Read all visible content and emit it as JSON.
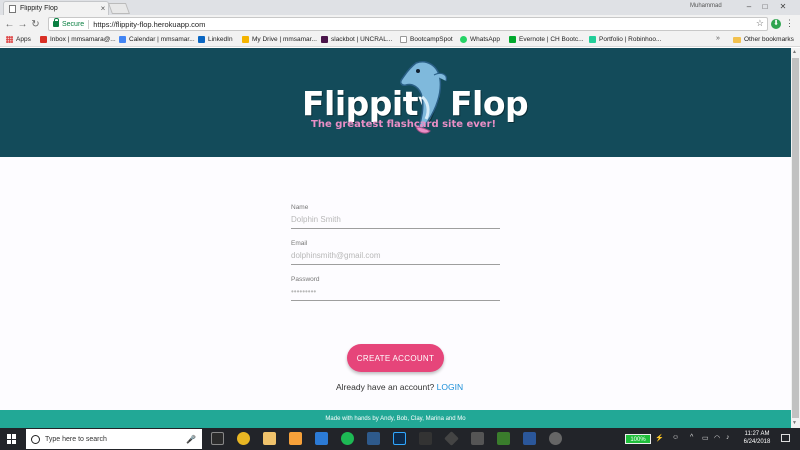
{
  "browser": {
    "tab_title": "Flippity Flop",
    "profile_name": "Muhammad",
    "secure_label": "Secure",
    "url": "https://flippity-flop.herokuapp.com",
    "bookmarks": [
      "Apps",
      "Inbox | mmsamara@...",
      "Calendar | mmsamar...",
      "LinkedIn",
      "My Drive | mmsamar...",
      "slackbot | UNCRAL...",
      "BootcampSpot",
      "WhatsApp",
      "Evernote | CH Bootc...",
      "Portfolio | Robinhoo...",
      "Other bookmarks"
    ],
    "more_bookmarks": "»"
  },
  "header": {
    "logo_text": "Flippity Flop",
    "tagline": "The greatest flashcard site ever!"
  },
  "form": {
    "name_label": "Name",
    "name_placeholder": "Dolphin Smith",
    "email_label": "Email",
    "email_placeholder": "dolphinsmith@gmail.com",
    "password_label": "Password",
    "password_placeholder": "•••••••••",
    "create_button": "CREATE ACCOUNT",
    "login_prompt": "Already have an account?",
    "login_link": "LOGIN"
  },
  "footer": {
    "credits": "Made with hands by Andy, Bob, Clay, Marina and Mo"
  },
  "taskbar": {
    "search_placeholder": "Type here to search",
    "battery_percent": "100%",
    "time": "11:27 AM",
    "date": "6/24/2018"
  },
  "colors": {
    "banner": "#134b5a",
    "button": "#e6457a",
    "footer": "#22a896",
    "link": "#1b8fd8"
  }
}
